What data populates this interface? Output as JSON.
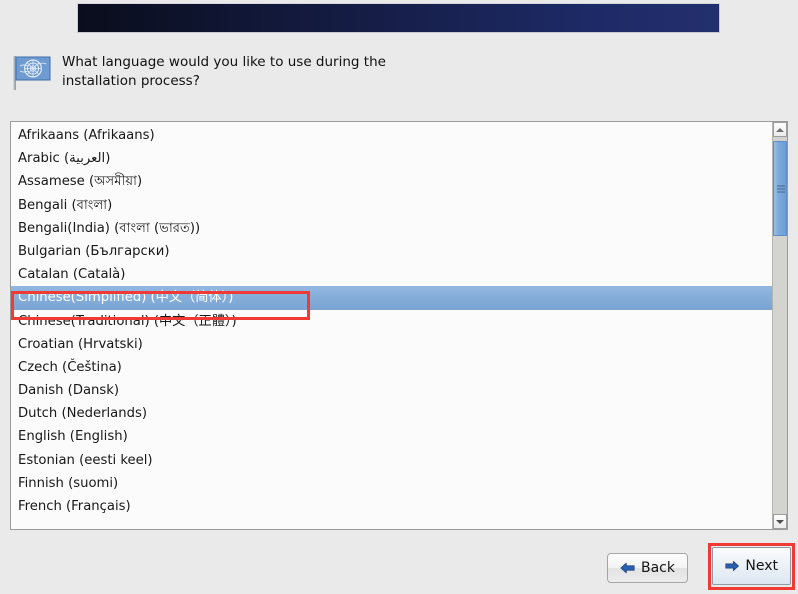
{
  "window": {
    "background_color": "#eaeaea",
    "banner": {
      "name": "installer-banner",
      "gradient_from": "#0a0d1c",
      "gradient_to": "#23306e"
    }
  },
  "prompt": {
    "icon": "un-flag-icon",
    "text": "What language would you like to use during the\ninstallation process?"
  },
  "language_list": {
    "selected_index": 7,
    "items": [
      "Afrikaans (Afrikaans)",
      "Arabic (العربية)",
      "Assamese (অসমীয়া)",
      "Bengali (বাংলা)",
      "Bengali(India) (বাংলা (ভারত))",
      "Bulgarian (Български)",
      "Catalan (Català)",
      "Chinese(Simplified) (中文（简体）)",
      "Chinese(Traditional) (中文（正體）)",
      "Croatian (Hrvatski)",
      "Czech (Čeština)",
      "Danish (Dansk)",
      "Dutch (Nederlands)",
      "English (English)",
      "Estonian (eesti keel)",
      "Finnish (suomi)",
      "French (Français)"
    ]
  },
  "scrollbar": {
    "up_icon": "chevron-up-icon",
    "down_icon": "chevron-down-icon",
    "thumb_color": "#7eaadd"
  },
  "footer": {
    "back": {
      "label": "Back",
      "icon": "arrow-left-icon"
    },
    "next": {
      "label": "Next",
      "icon": "arrow-right-icon"
    }
  },
  "annotations": {
    "highlight_color": "#ef3b34",
    "targets": [
      "selected-language-row",
      "next-button"
    ]
  }
}
